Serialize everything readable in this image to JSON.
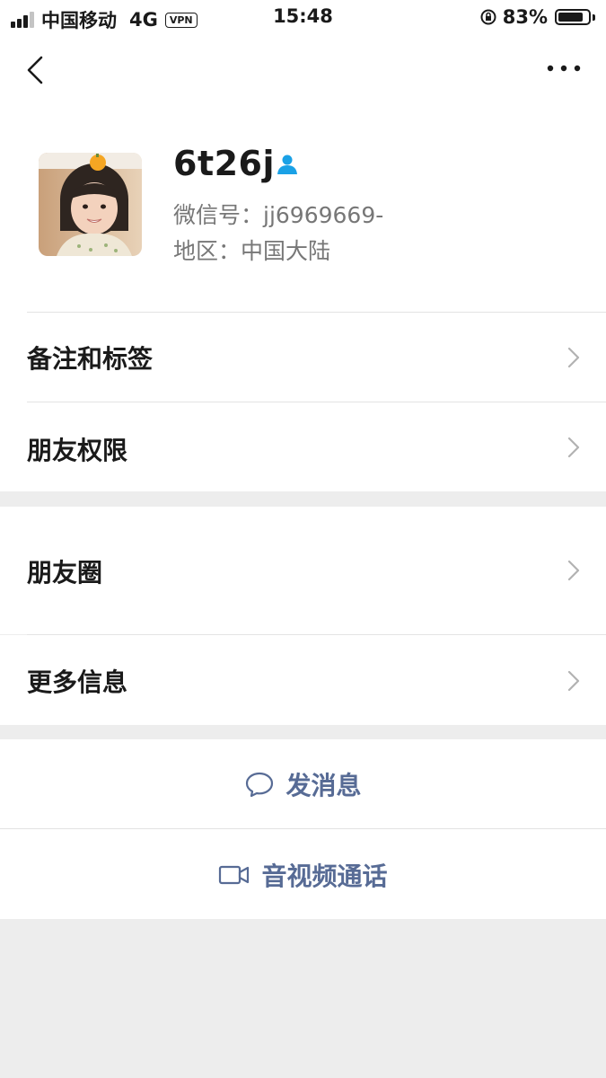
{
  "status_bar": {
    "carrier": "中国移动",
    "network": "4G",
    "vpn": "VPN",
    "time": "15:48",
    "battery_percent_text": "83%",
    "battery_level": 0.83
  },
  "profile": {
    "name": "6t26j",
    "wechat_id": "微信号：jj6969669-",
    "region": "地区：中国大陆"
  },
  "menu": {
    "remarks_tags": "备注和标签",
    "friend_permissions": "朋友权限",
    "moments": "朋友圈",
    "more_info": "更多信息"
  },
  "actions": {
    "send_message": "发消息",
    "video_call": "音视频通话"
  },
  "colors": {
    "link": "#576b95",
    "verify": "#1aa1e6",
    "background": "#ededed"
  }
}
